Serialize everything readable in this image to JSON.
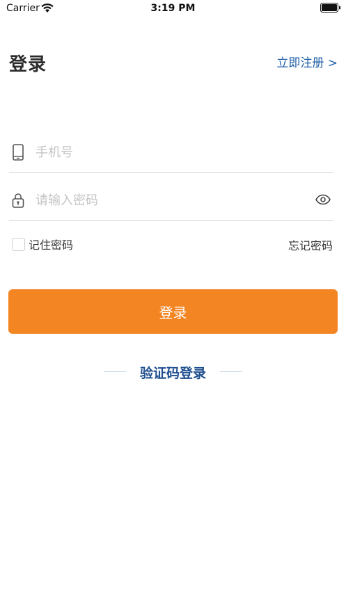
{
  "status_bar": {
    "carrier": "Carrier",
    "time": "3:19 PM"
  },
  "header": {
    "title": "登录",
    "register_link": "立即注册 >"
  },
  "form": {
    "phone_placeholder": "手机号",
    "phone_value": "",
    "password_placeholder": "请输入密码",
    "password_value": "",
    "remember_label": "记住密码",
    "remember_checked": false,
    "forgot_label": "忘记密码",
    "login_button": "登录"
  },
  "alt_login": {
    "sms_label": "验证码登录"
  },
  "colors": {
    "accent": "#f38523",
    "link": "#1f5fa8",
    "sms_link": "#1f4f8f"
  },
  "icons": {
    "wifi": "wifi-icon",
    "battery": "battery-icon",
    "phone": "phone-icon",
    "lock": "lock-icon",
    "eye": "eye-icon"
  }
}
